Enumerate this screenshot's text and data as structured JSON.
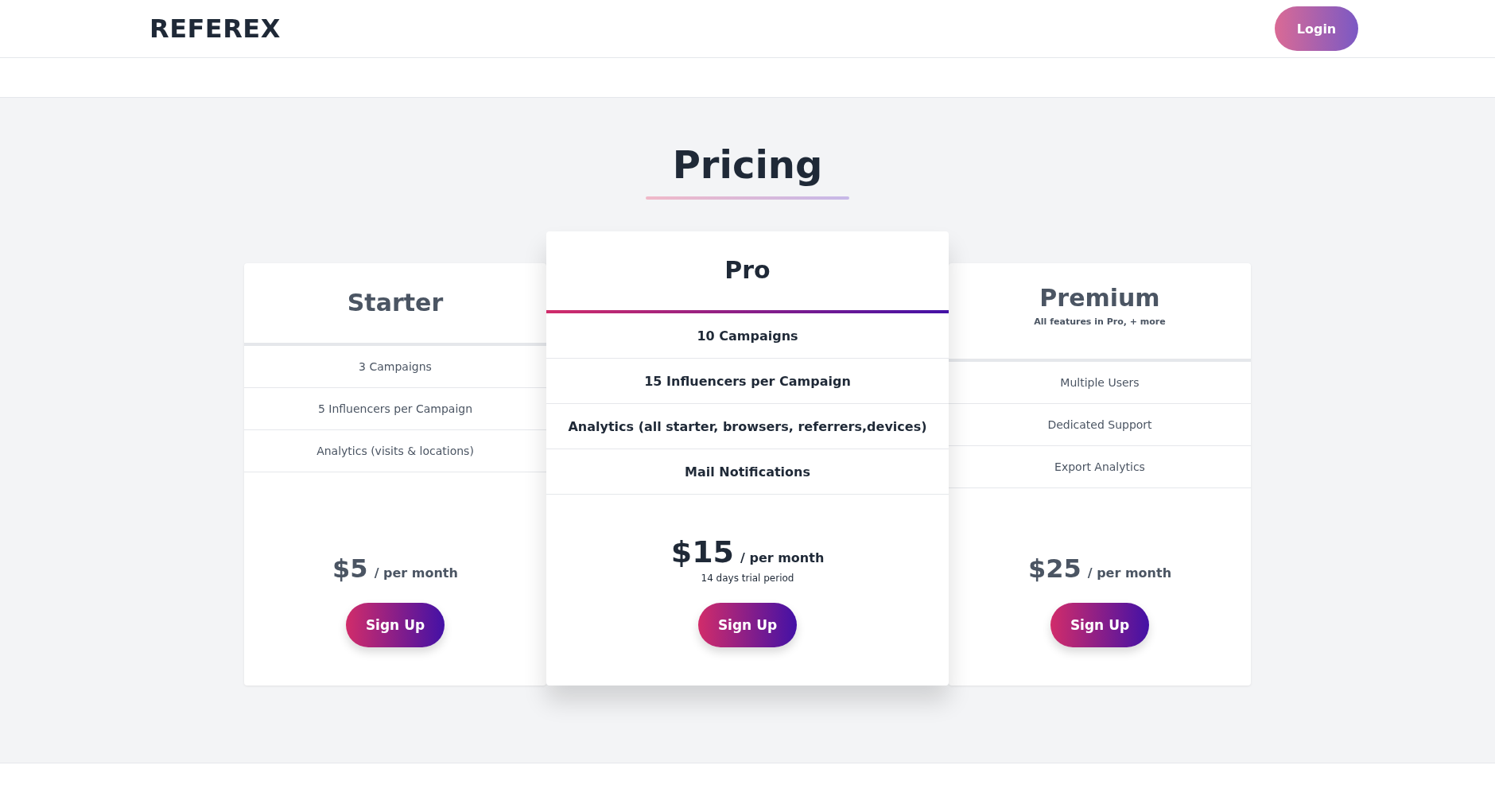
{
  "header": {
    "logo": "REFEREX",
    "login_button": "Login"
  },
  "pricing": {
    "title": "Pricing",
    "plans": [
      {
        "name": "Starter",
        "featured": false,
        "features": [
          "3 Campaigns",
          "5 Influencers per Campaign",
          "Analytics (visits & locations)"
        ],
        "price": "$5",
        "period": "/ per month",
        "button": "Sign Up"
      },
      {
        "name": "Pro",
        "featured": true,
        "features": [
          "10 Campaigns",
          "15 Influencers per Campaign",
          "Analytics (all starter, browsers, referrers,devices)",
          "Mail Notifications"
        ],
        "price": "$15",
        "period": "/ per month",
        "note": "14 days trial period",
        "button": "Sign Up"
      },
      {
        "name": "Premium",
        "subtitle": "All features in Pro, + more",
        "featured": false,
        "features": [
          "Multiple Users",
          "Dedicated Support",
          "Export Analytics"
        ],
        "price": "$25",
        "period": "/ per month",
        "button": "Sign Up"
      }
    ]
  }
}
